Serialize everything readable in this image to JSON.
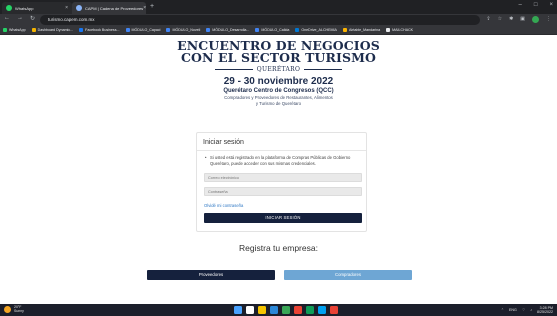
{
  "browser": {
    "tabs": [
      {
        "title": "WhatsApp",
        "favicon_color": "#25d366"
      },
      {
        "title": "CAPM | Cadena de Proveedores",
        "favicon_color": "#8ab4f8"
      }
    ],
    "url": "turismo.capem.com.mx",
    "bookmarks": [
      {
        "label": "WhatsApp",
        "color": "#25d366"
      },
      {
        "label": "Dashboard Dynamic...",
        "color": "#f4b400"
      },
      {
        "label": "Facebook Business...",
        "color": "#1877f2"
      },
      {
        "label": "MÓDULO_Capaci",
        "color": "#4285f4"
      },
      {
        "label": "MÓDULO_Noveli",
        "color": "#4285f4"
      },
      {
        "label": "MÓDULO_Desarrolla...",
        "color": "#4285f4"
      },
      {
        "label": "MÓDULO_Calida",
        "color": "#4285f4"
      },
      {
        "label": "OneDrive_ALCHEMIA",
        "color": "#0078d4"
      },
      {
        "label": "Airtable_Mandarina",
        "color": "#fcb400"
      },
      {
        "label": "MAILCHACK",
        "color": "#e8eaed"
      }
    ]
  },
  "hero": {
    "line1": "ENCUENTRO DE NEGOCIOS",
    "line2": "CON EL SECTOR TURISMO",
    "city": "QUERÉTARO",
    "dates": "29 - 30 noviembre 2022",
    "venue": "Querétaro Centro de Congresos (QCC)",
    "subtitle1": "Compradores y Proveedores de Restaurantes, Alimentos",
    "subtitle2": "y Turismo de Querétaro"
  },
  "login": {
    "title": "Iniciar sesión",
    "notice": "Si usted está registrado en la plataforma de Compras Públicas de Gobierno Querétaro, puede acceder con sus mismas credenciales.",
    "email_placeholder": "Correo electrónico",
    "password_placeholder": "Contraseña",
    "forgot_label": "Olvidé mi contraseña",
    "submit_label": "INICIAR SESIÓN"
  },
  "register": {
    "heading": "Registra tu empresa:",
    "providers_label": "Proveedores",
    "buyers_label": "Compradores"
  },
  "taskbar": {
    "weather_temp": "20°F",
    "weather_desc": "Sunny",
    "tray_lang": "ENG",
    "time": "3:28 PM",
    "date": "8/25/2022",
    "app_colors": [
      "#4aa3ff",
      "#ffffff",
      "#f5c400",
      "#2b88d8",
      "#3aa757",
      "#ea4335",
      "#0f9d58",
      "#00a1f1",
      "#e94235"
    ]
  },
  "colors": {
    "brand_navy": "#15213d",
    "buyer_blue": "#6ea6d4",
    "link_blue": "#2f78c4"
  }
}
